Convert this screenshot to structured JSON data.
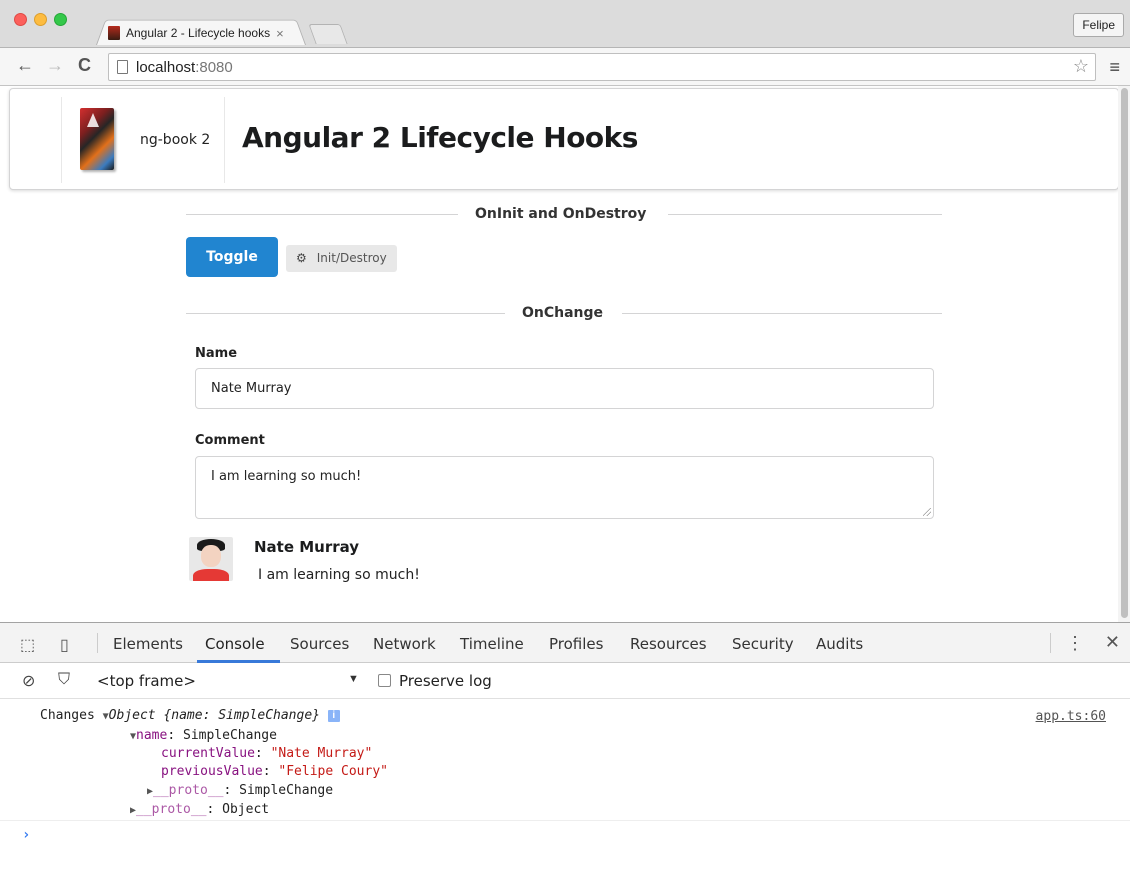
{
  "browser": {
    "tab_title": "Angular 2 - Lifecycle hooks",
    "tab_close": "×",
    "profile_name": "Felipe",
    "url_host": "localhost",
    "url_port": ":8080"
  },
  "header": {
    "brand": "ng-book 2",
    "title": "Angular 2 Lifecycle Hooks"
  },
  "sections": {
    "oninit_title": "OnInit and OnDestroy",
    "onchange_title": "OnChange"
  },
  "oninit": {
    "toggle_label": "Toggle",
    "tag_label": "Init/Destroy"
  },
  "form": {
    "name_label": "Name",
    "name_value": "Nate Murray",
    "comment_label": "Comment",
    "comment_value": "I am learning so much!"
  },
  "comment": {
    "author": "Nate Murray",
    "text": "I am learning so much!"
  },
  "devtools": {
    "tabs": [
      "Elements",
      "Console",
      "Sources",
      "Network",
      "Timeline",
      "Profiles",
      "Resources",
      "Security",
      "Audits"
    ],
    "active_tab": "Console",
    "frame": "<top frame>",
    "preserve_log": "Preserve log",
    "console": {
      "label": "Changes",
      "object_summary": "Object {name: SimpleChange}",
      "source": "app.ts:60",
      "name_key": "name",
      "name_type": "SimpleChange",
      "current_key": "currentValue",
      "current_value": "\"Nate Murray\"",
      "previous_key": "previousValue",
      "previous_value": "\"Felipe Coury\"",
      "inner_proto_key": "__proto__",
      "inner_proto_type": "SimpleChange",
      "outer_proto_key": "__proto__",
      "outer_proto_type": "Object",
      "info_badge": "i",
      "prompt": "›"
    }
  },
  "colors": {
    "primary_button": "#2185d0",
    "devtools_active": "#3879d9",
    "string_value": "#c41a16",
    "property_name": "#881280"
  }
}
